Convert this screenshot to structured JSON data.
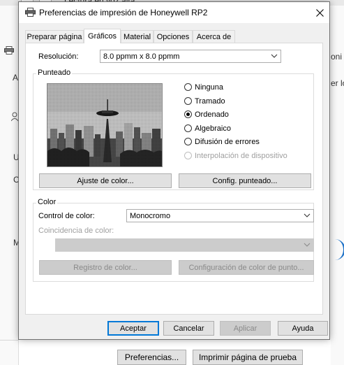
{
  "background": {
    "title_fragment": "Lectura en voz alta",
    "left_fragments": [
      "A",
      "U",
      "C",
      "M"
    ],
    "right_fragments": [
      "oni",
      "er lo"
    ],
    "buttons": {
      "preferences": "Preferencias...",
      "print_test": "Imprimir página de prueba"
    }
  },
  "dialog": {
    "title": "Preferencias de impresión de Honeywell RP2",
    "close_glyph": "✕",
    "tabs": [
      {
        "label": "Preparar página"
      },
      {
        "label": "Gráficos"
      },
      {
        "label": "Material"
      },
      {
        "label": "Opciones"
      },
      {
        "label": "Acerca de"
      }
    ],
    "active_tab": "Gráficos",
    "resolution": {
      "label": "Resolución:",
      "value": "8.0 ppmm x 8.0 ppmm"
    },
    "dithering": {
      "label": "Punteado",
      "options": [
        {
          "label": "Ninguna",
          "checked": false,
          "enabled": true
        },
        {
          "label": "Tramado",
          "checked": false,
          "enabled": true
        },
        {
          "label": "Ordenado",
          "checked": true,
          "enabled": true
        },
        {
          "label": "Algebraico",
          "checked": false,
          "enabled": true
        },
        {
          "label": "Difusión de errores",
          "checked": false,
          "enabled": true
        },
        {
          "label": "Interpolación de dispositivo",
          "checked": false,
          "enabled": false
        }
      ],
      "color_adjust_button": "Ajuste de color...",
      "dither_config_button": "Config. punteado..."
    },
    "color": {
      "label": "Color",
      "control_label": "Control de color:",
      "control_value": "Monocromo",
      "match_label": "Coincidencia de color:",
      "match_value": "",
      "register_button": "Registro de color...",
      "dot_config_button": "Configuración de color de punto..."
    },
    "footer": {
      "ok": "Aceptar",
      "cancel": "Cancelar",
      "apply": "Aplicar",
      "help": "Ayuda"
    }
  }
}
